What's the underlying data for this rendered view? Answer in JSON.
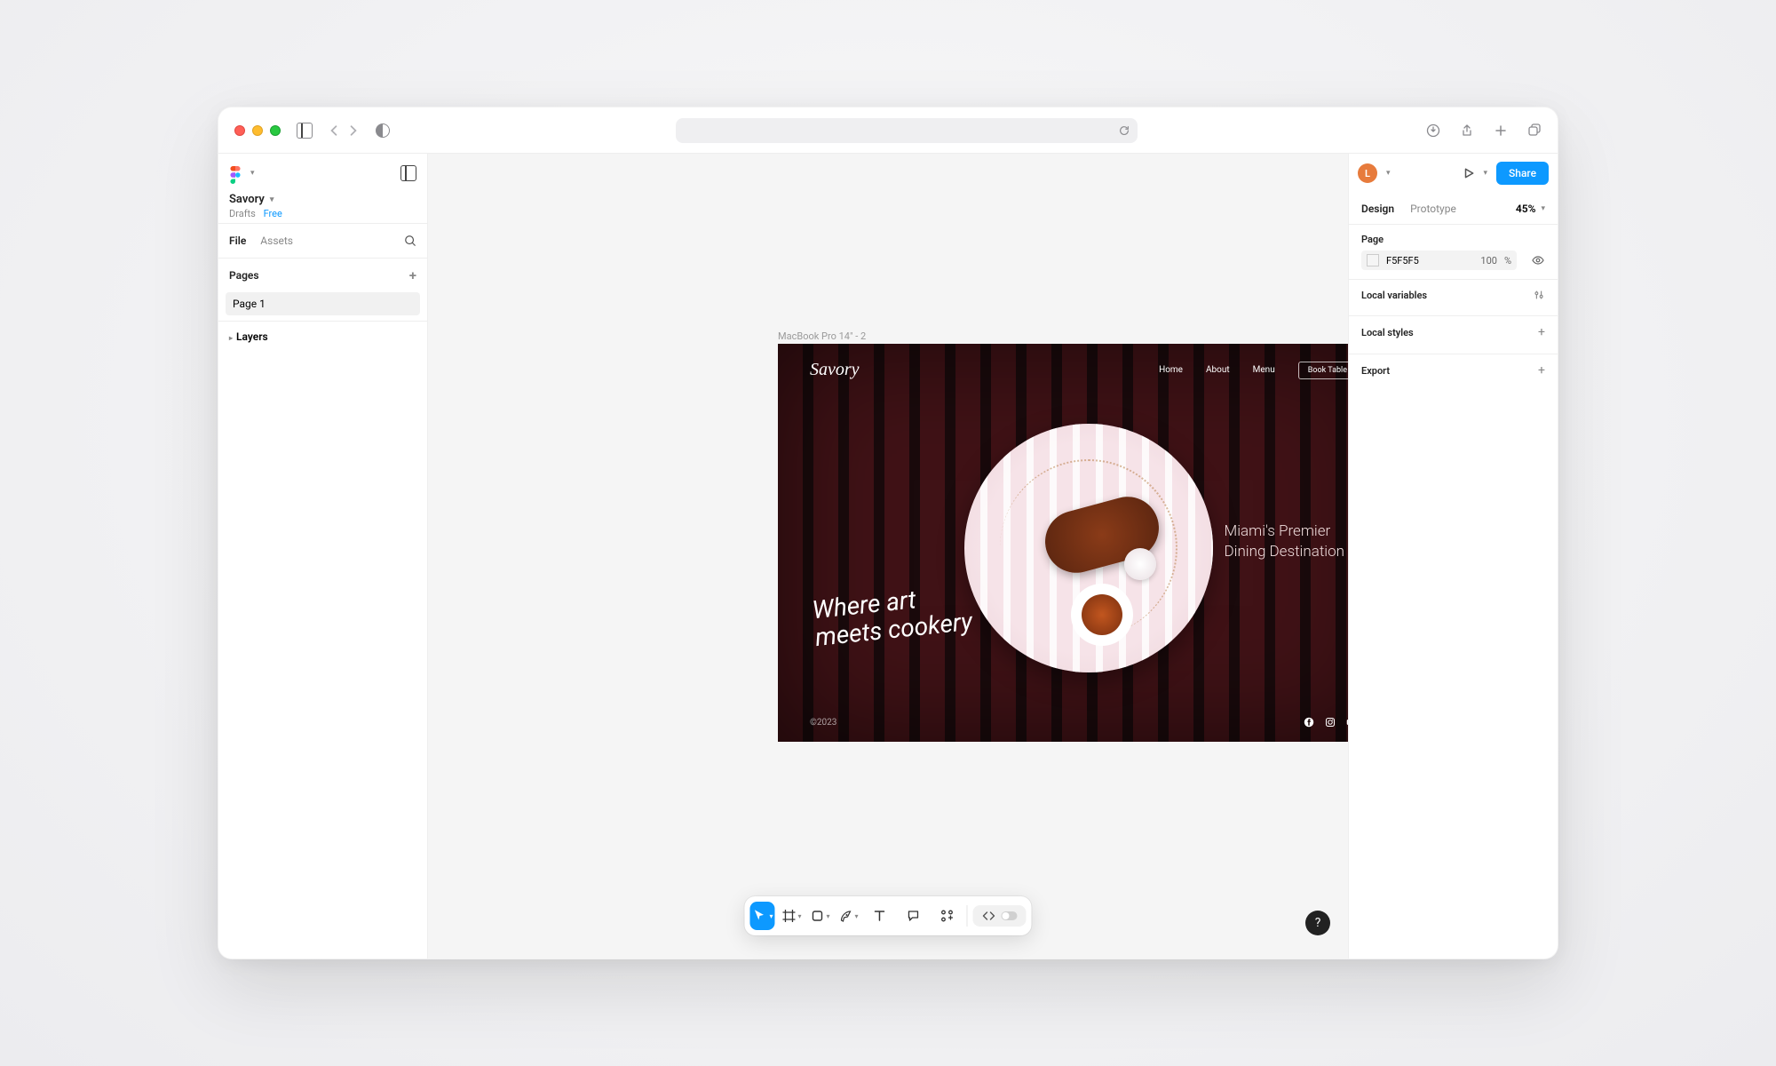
{
  "browser": {
    "address_placeholder": ""
  },
  "left": {
    "file_title": "Savory",
    "drafts_label": "Drafts",
    "free_label": "Free",
    "tabs": {
      "file": "File",
      "assets": "Assets"
    },
    "pages_header": "Pages",
    "page1": "Page 1",
    "layers_header": "Layers"
  },
  "frame": {
    "label": "MacBook Pro 14\" - 2",
    "brand": "Savory",
    "nav": {
      "home": "Home",
      "about": "About",
      "menu": "Menu",
      "book": "Book Table"
    },
    "tagline_left_l1": "Where art",
    "tagline_left_l2": "meets cookery",
    "tagline_right_l1": "Miami's Premier",
    "tagline_right_l2": "Dining Destination",
    "copyright": "©2023"
  },
  "right": {
    "avatar_initial": "L",
    "share_label": "Share",
    "tabs": {
      "design": "Design",
      "prototype": "Prototype"
    },
    "zoom": "45%",
    "page_header": "Page",
    "page_color": "F5F5F5",
    "page_opacity": "100",
    "pct_sign": "%",
    "local_variables": "Local variables",
    "local_styles": "Local styles",
    "export": "Export"
  },
  "help": "?"
}
